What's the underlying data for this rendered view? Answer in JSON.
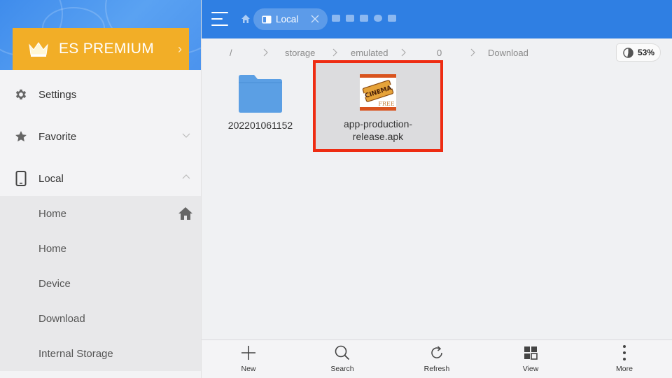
{
  "sidebar": {
    "premium_label": "ES PREMIUM",
    "items": [
      {
        "label": "Settings",
        "icon": "gear-icon"
      },
      {
        "label": "Favorite",
        "icon": "star-icon"
      },
      {
        "label": "Local",
        "icon": "phone-icon"
      }
    ],
    "local_subitems": [
      {
        "label": "Home"
      },
      {
        "label": "Home"
      },
      {
        "label": "Device"
      },
      {
        "label": "Download"
      },
      {
        "label": "Internal Storage"
      }
    ]
  },
  "topbar": {
    "active_tab": "Local"
  },
  "breadcrumb": [
    "/",
    "storage",
    "emulated",
    "0",
    "Download"
  ],
  "storage_usage": "53%",
  "files": [
    {
      "name": "202201061152",
      "type": "folder",
      "icon": "folder-icon"
    },
    {
      "name": "app-production-release.apk",
      "type": "apk",
      "icon": "cinema-apk-icon",
      "selected": true
    }
  ],
  "toolbar": [
    {
      "label": "New",
      "icon": "plus-icon"
    },
    {
      "label": "Search",
      "icon": "search-icon"
    },
    {
      "label": "Refresh",
      "icon": "refresh-icon"
    },
    {
      "label": "View",
      "icon": "grid-view-icon"
    },
    {
      "label": "More",
      "icon": "more-vert-icon"
    }
  ],
  "colors": {
    "topbar": "#2f7fe3",
    "premium": "#f2ae27",
    "highlight": "#ee2c12"
  }
}
